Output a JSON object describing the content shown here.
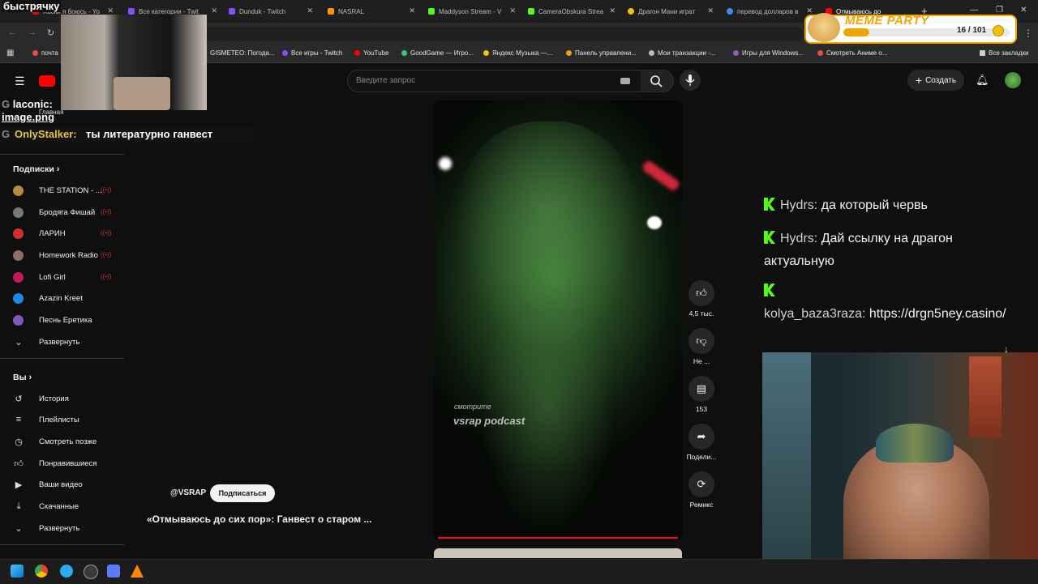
{
  "overlay": {
    "title": "быстрячку",
    "pip_chat_user": "laconic:",
    "pip_chat_file": "image.png",
    "chat_user": "OnlyStalker:",
    "chat_text": "ты литературно ганвест"
  },
  "tabs": [
    {
      "label": "Хаски я боюсь - Yo",
      "color": "#ff0000"
    },
    {
      "label": "Все категории - Twit",
      "color": "#9146ff"
    },
    {
      "label": "Dunduk - Twitch",
      "color": "#9146ff"
    },
    {
      "label": "NASRAL",
      "color": "#ff9800"
    },
    {
      "label": "Maddyson Stream - V",
      "color": "#53fc18"
    },
    {
      "label": "CameraObskura Strea",
      "color": "#53fc18"
    },
    {
      "label": "Драгон Мани играт",
      "color": "#f4c20d"
    },
    {
      "label": "перевод долларов в",
      "color": "#4285f4"
    },
    {
      "label": "Отмываюсь до",
      "color": "#ff0000"
    }
  ],
  "bookmarks": [
    {
      "label": "почта",
      "color": "#e74c3c"
    },
    {
      "label": "GISMETEO: Погода...",
      "color": "#3498db"
    },
    {
      "label": "Все игры - Twitch",
      "color": "#9146ff"
    },
    {
      "label": "YouTube",
      "color": "#ff0000"
    },
    {
      "label": "GoodGame — Игро...",
      "color": "#2ecc71"
    },
    {
      "label": "Яндекс Музыка —...",
      "color": "#f1c40f"
    },
    {
      "label": "Панель управлени...",
      "color": "#f39c12"
    },
    {
      "label": "Мои транзакции -...",
      "color": "#bbbbbb"
    },
    {
      "label": "Игры для Windows...",
      "color": "#9b59b6"
    },
    {
      "label": "Смотреть Аниме о...",
      "color": "#e74c3c"
    },
    {
      "label": "Все закладки",
      "color": "#cccccc"
    }
  ],
  "youtube": {
    "search_placeholder": "Введите запрос",
    "create_label": "Создать",
    "home_label": "Главная",
    "subscriptions_header": "Подписки",
    "subscriptions": [
      {
        "name": "THE STATION - ...",
        "color": "#b58a3a"
      },
      {
        "name": "Бродяга Фишай",
        "color": "#777777"
      },
      {
        "name": "ЛАРИН",
        "color": "#d32f2f"
      },
      {
        "name": "Homework Radio",
        "color": "#8d6e63"
      },
      {
        "name": "Lofi Girl",
        "color": "#c2185b"
      },
      {
        "name": "Azazin Kreet",
        "color": "#1e88e5"
      },
      {
        "name": "Песнь Еретика",
        "color": "#7e57c2"
      }
    ],
    "expand_label": "Развернуть",
    "you_header": "Вы",
    "you_items": [
      {
        "label": "История",
        "icon": "history-icon"
      },
      {
        "label": "Плейлисты",
        "icon": "playlist-icon"
      },
      {
        "label": "Смотреть позже",
        "icon": "clock-icon"
      },
      {
        "label": "Понравившиеся",
        "icon": "thumb-up-icon"
      },
      {
        "label": "Ваши видео",
        "icon": "video-icon"
      },
      {
        "label": "Скачанные",
        "icon": "download-icon"
      }
    ],
    "expand_label_2": "Развернуть",
    "channel": "@VSRAP",
    "subscribe_label": "Подписаться",
    "video_title": "«Отмываюсь до сих пор»: Ганвест о старом ...",
    "watch_small": "смотрите",
    "watch_big": "vsrap podcast",
    "progress_fraction": 0.98,
    "actions": {
      "like_count": "4,5 тыс.",
      "dislike_label": "Не ...",
      "comments_count": "153",
      "share_label": "Подели...",
      "remix_label": "Ремикс"
    }
  },
  "meme_party": {
    "label": "MEME PARTY",
    "progress_text": "16 / 101",
    "progress_value": 16,
    "progress_max": 101
  },
  "stream_chat": [
    {
      "user": "Hydrs:",
      "text": "да который червь"
    },
    {
      "user": "Hydrs:",
      "text": "Дай ссылку на драгон актуальную"
    },
    {
      "user": "kolya_baza3raza:",
      "text": "https://drgn5ney.casino/"
    }
  ]
}
